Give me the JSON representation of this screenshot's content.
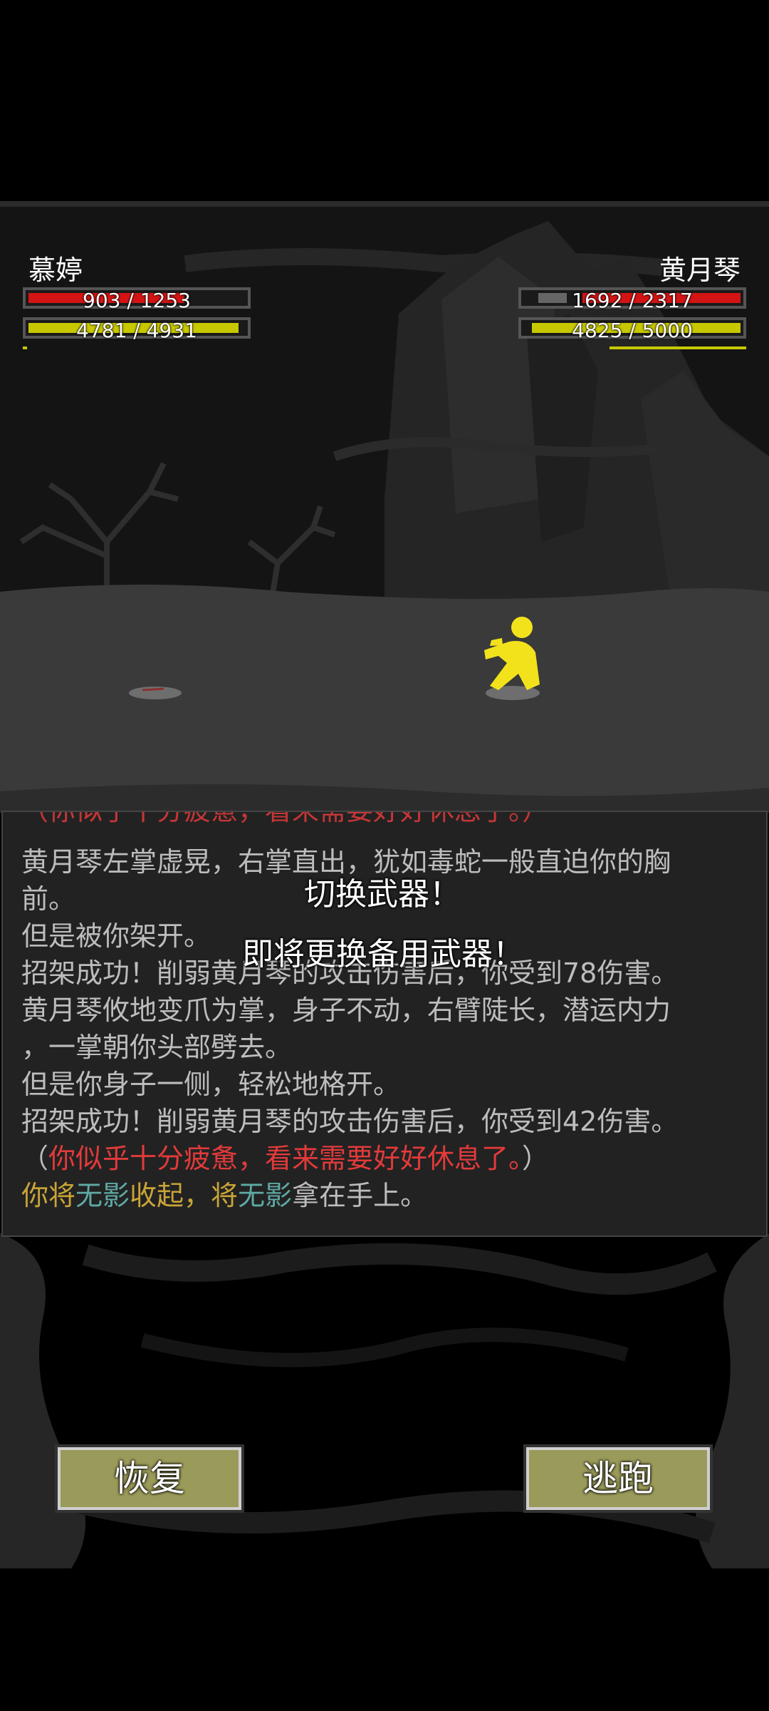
{
  "player": {
    "name": "慕婷",
    "hp": "903 / 1253",
    "mp": "4781 / 4931",
    "hp_fraction": 0.72,
    "mp_fraction": 0.97
  },
  "enemy": {
    "name": "黄月琴",
    "hp": "1692 / 2317",
    "mp": "4825 / 5000",
    "hp_fraction": 0.73,
    "mp_fraction": 0.965
  },
  "log": {
    "partial_top": "（你似乎十分疲惫，看来需要好好休息了。）",
    "line1": "黄月琴左掌虚晃，右掌直出，犹如毒蛇一般直迫你的胸",
    "line2": "前。",
    "line3": "但是被你架开。",
    "line4": "招架成功！削弱黄月琴的攻击伤害后，你受到78伤害。",
    "line5": "黄月琴攸地变爪为掌，身子不动，右臂陡长，潜运内力",
    "line6": "，一掌朝你头部劈去。",
    "line7": "但是你身子一侧，轻松地格开。",
    "line8": "招架成功！削弱黄月琴的攻击伤害后，你受到42伤害。",
    "line9_open": "（",
    "line9_red": "你似乎十分疲惫，看来需要好好休息了。",
    "line9_close": "）",
    "line10": {
      "p1": "你将",
      "p2": "无影",
      "p3": "收起，",
      "p4": "将",
      "p5": "无影",
      "p6": "拿在手上。"
    }
  },
  "popup": {
    "title": "切换武器！",
    "subtitle": "即将更换备用武器！"
  },
  "buttons": {
    "recover": "恢复",
    "flee": "逃跑"
  },
  "colors": {
    "hp": "#d41414",
    "mp": "#c8c800",
    "character": "#f2e21c",
    "button": "#9a9a5a"
  }
}
